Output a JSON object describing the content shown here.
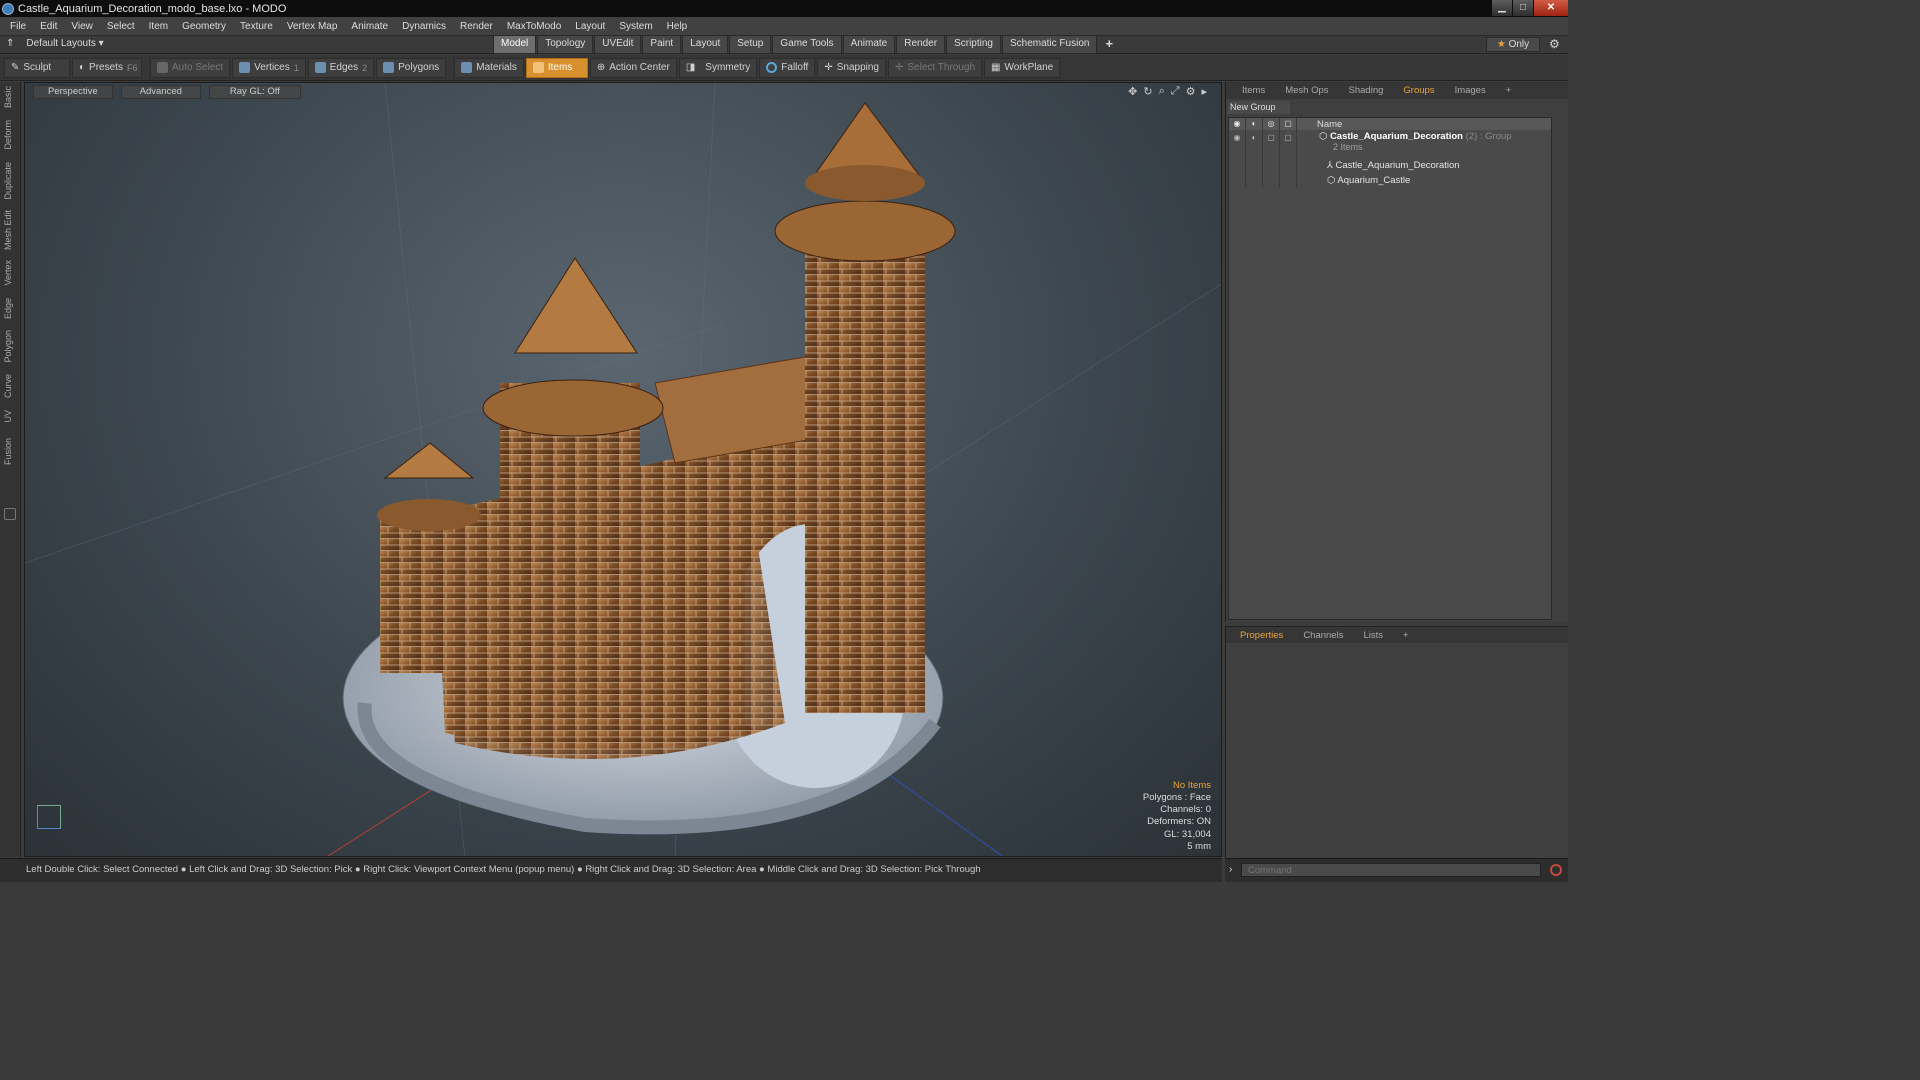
{
  "window": {
    "title": "Castle_Aquarium_Decoration_modo_base.lxo - MODO"
  },
  "menu": [
    "File",
    "Edit",
    "View",
    "Select",
    "Item",
    "Geometry",
    "Texture",
    "Vertex Map",
    "Animate",
    "Dynamics",
    "Render",
    "MaxToModo",
    "Layout",
    "System",
    "Help"
  ],
  "layout": {
    "selector": "Default Layouts ▾",
    "tabs": [
      "Model",
      "Topology",
      "UVEdit",
      "Paint",
      "Layout",
      "Setup",
      "Game Tools",
      "Animate",
      "Render",
      "Scripting",
      "Schematic Fusion"
    ],
    "plus": "+",
    "only": "Only"
  },
  "toolbar": {
    "sculpt": "Sculpt",
    "presets": "Presets",
    "presets_key": "F6",
    "auto_select": "Auto Select",
    "vertices": "Vertices",
    "vertices_n": "1",
    "edges": "Edges",
    "edges_n": "2",
    "polygons": "Polygons",
    "materials": "Materials",
    "items": "Items",
    "action_center": "Action Center",
    "symmetry": "Symmetry",
    "falloff": "Falloff",
    "snapping": "Snapping",
    "select_through": "Select Through",
    "workplane": "WorkPlane"
  },
  "side_tabs": [
    "Basic",
    "Deform",
    "Duplicate",
    "Mesh Edit",
    "Vertex",
    "Edge",
    "Polygon",
    "Curve",
    "UV",
    "Fusion"
  ],
  "viewport": {
    "view": "Perspective",
    "shading": "Advanced",
    "raygl": "Ray GL: Off",
    "info": {
      "items": "No Items",
      "polygons": "Polygons : Face",
      "channels": "Channels: 0",
      "deformers": "Deformers: ON",
      "gl": "GL: 31,004",
      "scale": "5 mm"
    }
  },
  "status": "Left Double Click: Select Connected ● Left Click and Drag: 3D Selection: Pick ● Right Click: Viewport Context Menu (popup menu) ● Right Click and Drag: 3D Selection: Area ● Middle Click and Drag: 3D Selection: Pick Through",
  "groups_panel": {
    "tabs": [
      "Items",
      "Mesh Ops",
      "Shading",
      "Groups",
      "Images",
      "+"
    ],
    "new_group": "New Group",
    "col_name": "Name",
    "group_name": "Castle_Aquarium_Decoration",
    "group_count": "(2)",
    "group_type": ": Group",
    "group_sub": "2 Items",
    "children": [
      "Castle_Aquarium_Decoration",
      "Aquarium_Castle"
    ]
  },
  "properties_panel": {
    "tabs": [
      "Properties",
      "Channels",
      "Lists",
      "+"
    ]
  },
  "command": {
    "placeholder": "Command"
  },
  "colors": {
    "accent": "#e8a23a",
    "active_tool": "#d88f2e",
    "close": "#c8402a"
  }
}
